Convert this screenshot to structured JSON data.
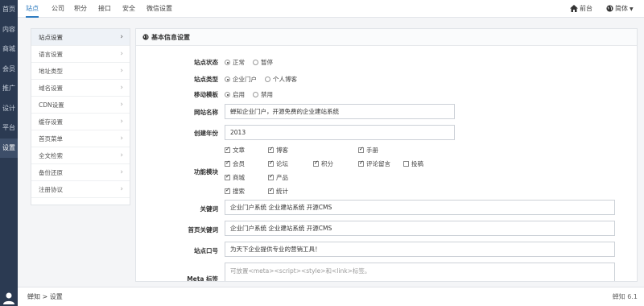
{
  "rail": {
    "items": [
      {
        "label": "首页"
      },
      {
        "label": "内容"
      },
      {
        "label": "商城"
      },
      {
        "label": "会员"
      },
      {
        "label": "推广"
      },
      {
        "label": "设计"
      },
      {
        "label": "平台"
      },
      {
        "label": "设置"
      }
    ],
    "active_index": 7
  },
  "topnav": {
    "tabs": [
      {
        "label": "站点"
      },
      {
        "label": "公司"
      },
      {
        "label": "积分"
      },
      {
        "label": "接口"
      },
      {
        "label": "安全"
      },
      {
        "label": "微信设置"
      }
    ],
    "front_label": "前台",
    "lang_label": "简体"
  },
  "subnav": {
    "items": [
      {
        "label": "站点设置"
      },
      {
        "label": "语言设置"
      },
      {
        "label": "地址类型"
      },
      {
        "label": "域名设置"
      },
      {
        "label": "CDN设置"
      },
      {
        "label": "缓存设置"
      },
      {
        "label": "首页菜单"
      },
      {
        "label": "全文检索"
      },
      {
        "label": "备份还原"
      },
      {
        "label": "注册协议"
      }
    ]
  },
  "panel": {
    "title": "基本信息设置",
    "site_status": {
      "label": "站点状态",
      "options": [
        "正常",
        "暂停"
      ],
      "selected": 0
    },
    "site_type": {
      "label": "站点类型",
      "options": [
        "企业门户",
        "个人博客"
      ],
      "selected": 0
    },
    "mobile_template": {
      "label": "移动模板",
      "options": [
        "启用",
        "禁用"
      ],
      "selected": 0
    },
    "site_name": {
      "label": "网站名称",
      "value": "蝉知企业门户，开源免费的企业建站系统"
    },
    "created_year": {
      "label": "创建年份",
      "value": "2013"
    },
    "modules": {
      "label": "功能模块",
      "items": [
        {
          "label": "文章",
          "checked": true
        },
        {
          "label": "博客",
          "checked": true
        },
        {
          "label": "手册",
          "checked": true
        },
        {
          "label": "会员",
          "checked": true
        },
        {
          "label": "论坛",
          "checked": true
        },
        {
          "label": "积分",
          "checked": true
        },
        {
          "label": "评论留言",
          "checked": true
        },
        {
          "label": "投稿",
          "checked": false
        },
        {
          "label": "商城",
          "checked": true
        },
        {
          "label": "产品",
          "checked": true
        },
        {
          "label": "搜索",
          "checked": true
        },
        {
          "label": "统计",
          "checked": true
        }
      ]
    },
    "keywords": {
      "label": "关键词",
      "value": "企业门户系统 企业建站系统 开源CMS"
    },
    "home_keywords": {
      "label": "首页关键词",
      "value": "企业门户系统 企业建站系统 开源CMS"
    },
    "slogan": {
      "label": "站点口号",
      "value": "为天下企业提供专业的营销工具！"
    },
    "meta": {
      "label": "Meta 标签",
      "placeholder": "可放置<meta><script><style>和<link>标签。"
    }
  },
  "statusbar": {
    "breadcrumb": "蝉知 > 设置",
    "version": "蝉知 6.1"
  },
  "colors": {
    "rail_bg": "#2b3a52",
    "accent": "#2f7cc0"
  }
}
